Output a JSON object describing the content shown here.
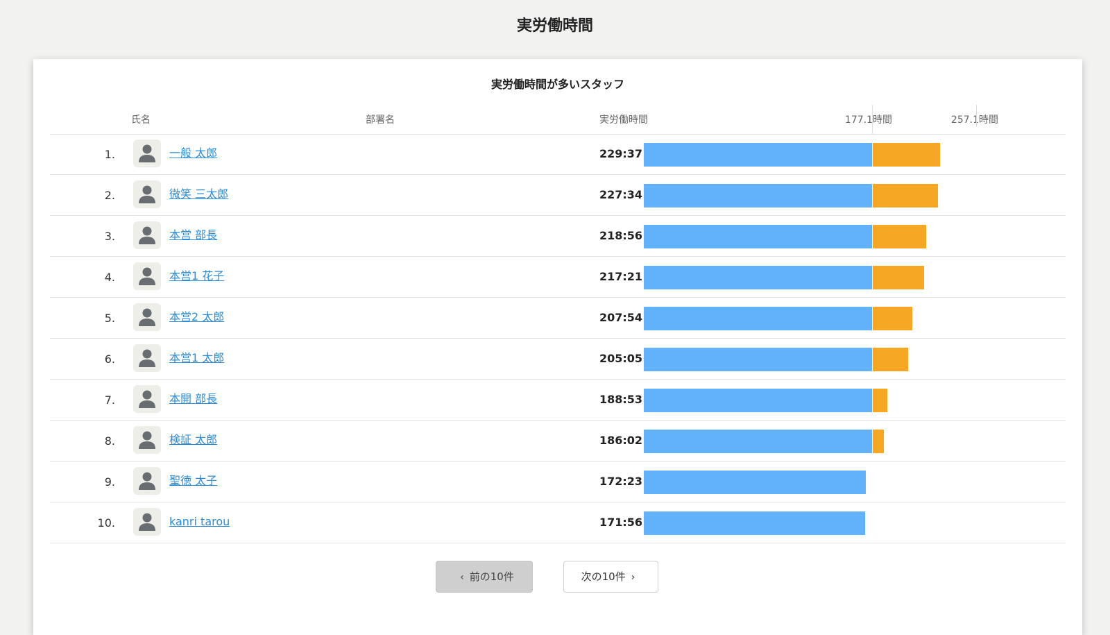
{
  "page": {
    "title": "実労働時間"
  },
  "card": {
    "title": "実労働時間が多いスタッフ"
  },
  "columns": {
    "name": "氏名",
    "department": "部署名",
    "hours": "実労働時間"
  },
  "reference_lines": [
    {
      "label": "177.1時間",
      "value": 177.1
    },
    {
      "label": "257.1時間",
      "value": 257.1
    }
  ],
  "colors": {
    "within": "#62b2fb",
    "excess": "#f5a623",
    "link": "#2b8cdc"
  },
  "staff": [
    {
      "rank": "1.",
      "name": "一般 太郎",
      "department": "",
      "hours": "229:37",
      "hours_value": 229.62
    },
    {
      "rank": "2.",
      "name": "微笑 三太郎",
      "department": "",
      "hours": "227:34",
      "hours_value": 227.57
    },
    {
      "rank": "3.",
      "name": "本営 部長",
      "department": "",
      "hours": "218:56",
      "hours_value": 218.93
    },
    {
      "rank": "4.",
      "name": "本営1 花子",
      "department": "",
      "hours": "217:21",
      "hours_value": 217.35
    },
    {
      "rank": "5.",
      "name": "本営2 太郎",
      "department": "",
      "hours": "207:54",
      "hours_value": 207.9
    },
    {
      "rank": "6.",
      "name": "本営1 太郎",
      "department": "",
      "hours": "205:05",
      "hours_value": 205.08
    },
    {
      "rank": "7.",
      "name": "本開 部長",
      "department": "",
      "hours": "188:53",
      "hours_value": 188.88
    },
    {
      "rank": "8.",
      "name": "検証 太郎",
      "department": "",
      "hours": "186:02",
      "hours_value": 186.03
    },
    {
      "rank": "9.",
      "name": "聖徳 太子",
      "department": "",
      "hours": "172:23",
      "hours_value": 172.38
    },
    {
      "rank": "10.",
      "name": "kanri tarou",
      "department": "",
      "hours": "171:56",
      "hours_value": 171.93
    }
  ],
  "pagination": {
    "prev_label": "前の10件",
    "next_label": "次の10件",
    "prev_icon": "chevron-left-icon",
    "next_icon": "chevron-right-icon"
  }
}
